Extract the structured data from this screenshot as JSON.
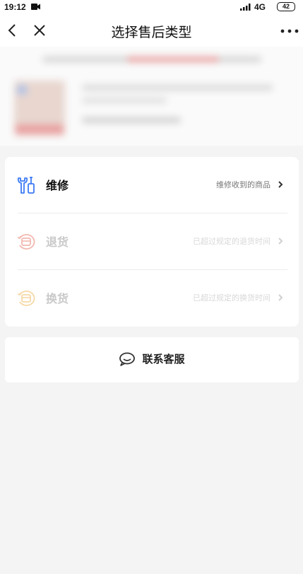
{
  "status_bar": {
    "time": "19:12",
    "network": "4G",
    "battery": "42"
  },
  "nav": {
    "title": "选择售后类型"
  },
  "options": [
    {
      "key": "repair",
      "label": "维修",
      "hint": "维修收到的商品",
      "enabled": true,
      "icon": "wrench-icon",
      "color": "#3d7bf5"
    },
    {
      "key": "return",
      "label": "退货",
      "hint": "已超过规定的退货时间",
      "enabled": false,
      "icon": "return-icon",
      "color": "#f3b8b0"
    },
    {
      "key": "exchange",
      "label": "换货",
      "hint": "已超过规定的换货时间",
      "enabled": false,
      "icon": "exchange-icon",
      "color": "#f5d9a6"
    }
  ],
  "service": {
    "label": "联系客服",
    "icon": "chat-bubble-icon"
  }
}
